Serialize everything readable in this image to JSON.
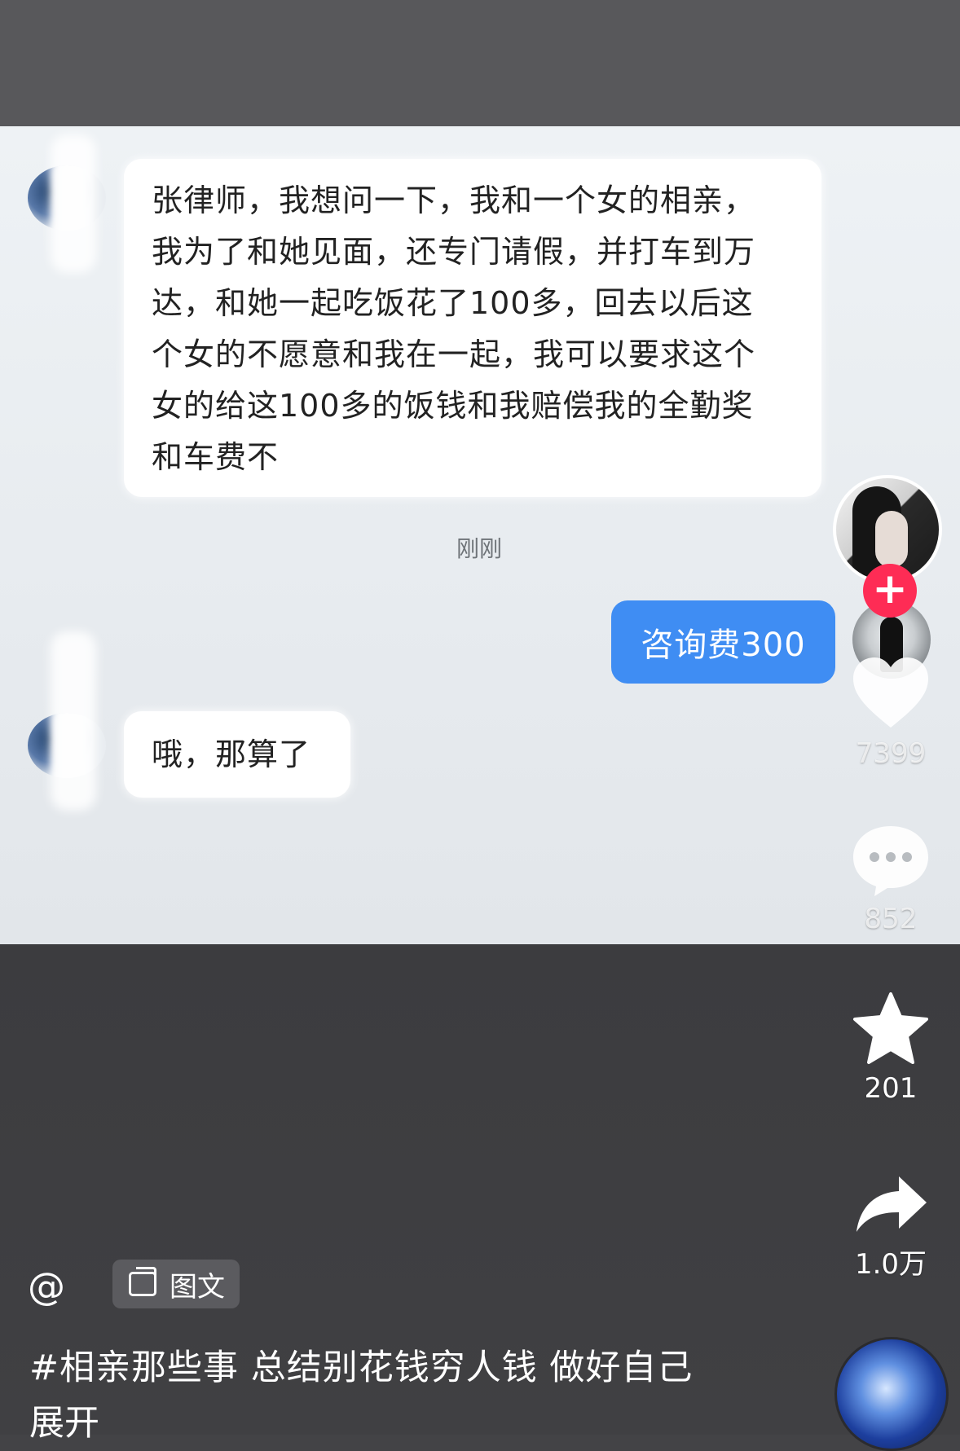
{
  "chat": {
    "message_1": "张律师，我想问一下，我和一个女的相亲，\n我为了和她见面，还专门请假，并打车到万\n达，和她一起吃饭花了100多，回去以后这\n个女的不愿意和我在一起，我可以要求这个\n女的给这100多的饭钱和我赔偿我的全勤奖\n和车费不",
    "timestamp": "刚刚",
    "reply": "咨询费300",
    "message_2": "哦，那算了"
  },
  "actions": {
    "follow": "+",
    "likes": "7399",
    "comments": "852",
    "favorites": "201",
    "shares": "1.0万"
  },
  "post": {
    "mention": "@",
    "type_label": "图文",
    "caption": "#相亲那些事 总结别花钱穷人钱 做好自己",
    "expand": "展开"
  },
  "icons": [
    "heart-icon",
    "comment-icon",
    "star-icon",
    "share-icon",
    "image-text-icon"
  ],
  "colors": {
    "accent_red": "#fe2c55",
    "reply_blue": "#3f8df3"
  }
}
